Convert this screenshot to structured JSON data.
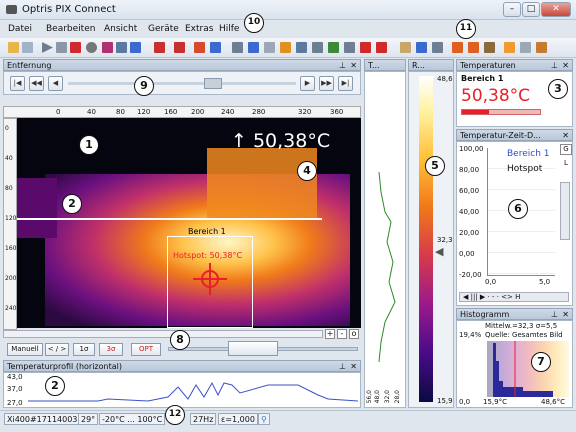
{
  "app": {
    "title": "Optris PIX Connect"
  },
  "menu": [
    "Datei",
    "Bearbeiten",
    "Ansicht",
    "Geräte",
    "Extras",
    "Hilfe"
  ],
  "panes": {
    "distance": "Entfernung",
    "temps": "Temperaturen",
    "temp_time": "Temperatur-Zeit-D...",
    "histogram": "Histogramm",
    "profile": "Temperaturprofil (horizontal)",
    "t_small": "T...",
    "r_small": "R..."
  },
  "ruler": [
    "0",
    "40",
    "80",
    "120",
    "160",
    "200",
    "240",
    "280",
    "320",
    "360"
  ],
  "vruler": [
    "0",
    "40",
    "80",
    "120",
    "160",
    "200",
    "240"
  ],
  "image": {
    "max_reading": "↑ 50,38°C",
    "area_label": "Bereich 1",
    "hotspot_label": "Hotspot: 50,38°C"
  },
  "temps_pane": {
    "area": "Bereich 1",
    "value": "50,38°C"
  },
  "colorbar": {
    "top": "48,6",
    "mid": "32,3",
    "bottom": "15,9"
  },
  "tt_chart": {
    "yticks": [
      "100,00",
      "80,00",
      "60,00",
      "40,00",
      "20,00",
      "0,00",
      "-20,00"
    ],
    "xticks": [
      "0,0",
      "5,0"
    ],
    "legend1": "Bereich 1",
    "legend2": "Hotspot",
    "tab_g": "G",
    "tab_l": "L"
  },
  "histo": {
    "stats": "Mittelw.=32,3 σ=5,5",
    "source": "Quelle: Gesamtes Bild",
    "percent": "19,4%",
    "x0": "0,0",
    "xmin": "15,9°C",
    "xmax": "48,6°C"
  },
  "profile": {
    "yticks": [
      "43,0",
      "37,0",
      "27,0"
    ]
  },
  "mini_ticks": [
    "56,0",
    "48,0",
    "32,0",
    "28,0"
  ],
  "buttons": {
    "manuell": "Manuell",
    "arrows": "< / >",
    "sigma1": "1σ",
    "sigma3": "3σ",
    "opt": "OPT"
  },
  "status": {
    "device": "Xi400#17114003",
    "fov": "29°",
    "range": "-20°C ... 100°C",
    "fps": "27Hz",
    "eps": "ε=1,000"
  },
  "callouts": [
    "1",
    "2",
    "3",
    "4",
    "5",
    "6",
    "7",
    "8",
    "9",
    "10",
    "11",
    "12",
    "2"
  ],
  "colors": {
    "accent_red": "#e8202a",
    "legend_blue": "#2a4dd0",
    "frame": "#1a2a44"
  }
}
